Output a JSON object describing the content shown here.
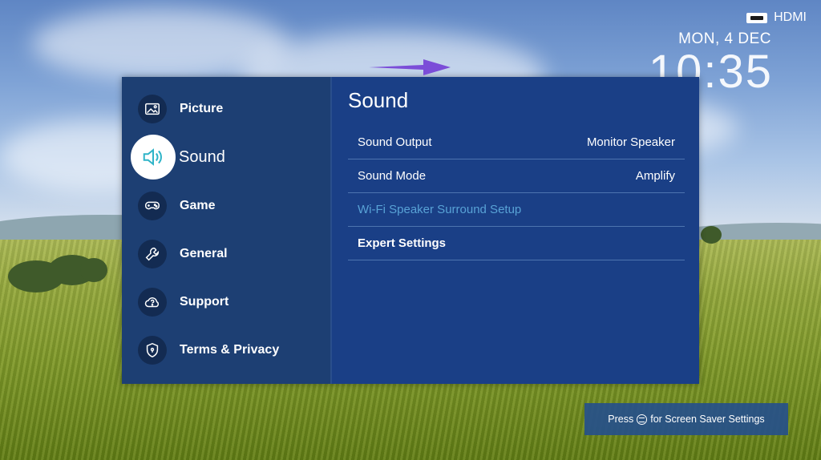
{
  "status": {
    "source_label": "HDMI",
    "date": "MON, 4 DEC",
    "time": "10:35"
  },
  "sidebar": {
    "items": [
      {
        "label": "Picture",
        "icon": "picture-icon",
        "active": false
      },
      {
        "label": "Sound",
        "icon": "speaker-icon",
        "active": true
      },
      {
        "label": "Game",
        "icon": "gamepad-icon",
        "active": false
      },
      {
        "label": "General",
        "icon": "wrench-icon",
        "active": false
      },
      {
        "label": "Support",
        "icon": "cloud-question-icon",
        "active": false
      },
      {
        "label": "Terms & Privacy",
        "icon": "shield-icon",
        "active": false
      }
    ]
  },
  "content": {
    "title": "Sound",
    "rows": [
      {
        "label": "Sound Output",
        "value": "Monitor Speaker",
        "disabled": false
      },
      {
        "label": "Sound Mode",
        "value": "Amplify",
        "disabled": false
      },
      {
        "label": "Wi-Fi Speaker Surround Setup",
        "value": "",
        "disabled": true
      },
      {
        "label": "Expert Settings",
        "value": "",
        "disabled": false
      }
    ]
  },
  "hint": {
    "prefix": "Press",
    "suffix": "for Screen Saver Settings"
  },
  "colors": {
    "sidebar_bg": "#1d3f73",
    "content_bg": "#1a3f86",
    "disabled_text": "#58a2d6",
    "annotation_arrow": "#7b4dd8"
  }
}
